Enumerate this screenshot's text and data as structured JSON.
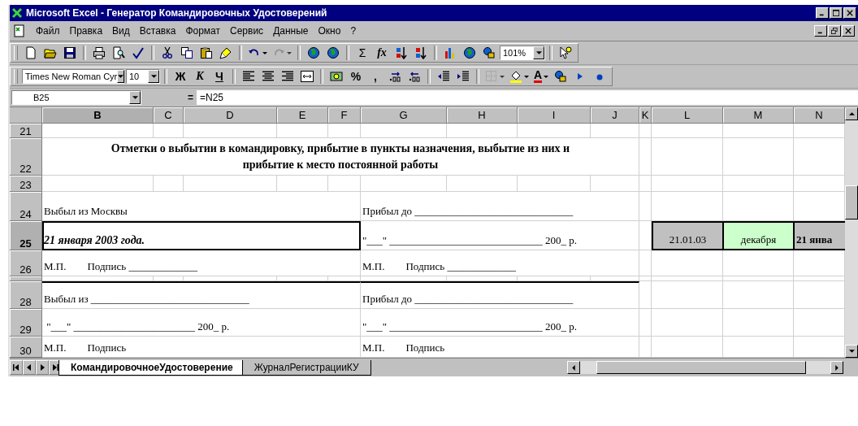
{
  "window": {
    "title": "Microsoft Excel - Генератор Командировочных Удостоверений"
  },
  "menu": [
    {
      "label": "Файл"
    },
    {
      "label": "Правка"
    },
    {
      "label": "Вид"
    },
    {
      "label": "Вставка"
    },
    {
      "label": "Формат"
    },
    {
      "label": "Сервис"
    },
    {
      "label": "Данные"
    },
    {
      "label": "Окно"
    },
    {
      "label": "?"
    }
  ],
  "standard_toolbar": [
    {
      "kind": "new"
    },
    {
      "kind": "open"
    },
    {
      "kind": "save"
    },
    {
      "kind": "sep"
    },
    {
      "kind": "print"
    },
    {
      "kind": "preview"
    },
    {
      "kind": "spell"
    },
    {
      "kind": "sep"
    },
    {
      "kind": "cut"
    },
    {
      "kind": "copy"
    },
    {
      "kind": "paste"
    },
    {
      "kind": "brush"
    },
    {
      "kind": "sep"
    },
    {
      "kind": "undo",
      "dropdown": true
    },
    {
      "kind": "redo",
      "dropdown": true,
      "disabled": true
    },
    {
      "kind": "sep"
    },
    {
      "kind": "globe"
    },
    {
      "kind": "globe"
    },
    {
      "kind": "sep"
    },
    {
      "kind": "glyph",
      "label": "Σ"
    },
    {
      "kind": "glyph-italic",
      "label": "fx"
    },
    {
      "kind": "sortasc"
    },
    {
      "kind": "sortdesc"
    },
    {
      "kind": "sep"
    },
    {
      "kind": "chart"
    },
    {
      "kind": "globe"
    },
    {
      "kind": "shapes"
    },
    {
      "kind": "zoom",
      "label": "101%"
    },
    {
      "kind": "sep"
    },
    {
      "kind": "help"
    }
  ],
  "formatting_toolbar": [
    {
      "kind": "font",
      "label": "Times New Roman Cyr"
    },
    {
      "kind": "size",
      "label": "10"
    },
    {
      "kind": "sep"
    },
    {
      "kind": "glyph-bold",
      "label": "Ж"
    },
    {
      "kind": "glyph-italic",
      "label": "К"
    },
    {
      "kind": "glyph-underline",
      "label": "Ч"
    },
    {
      "kind": "sep"
    },
    {
      "kind": "alignleft"
    },
    {
      "kind": "aligncenter"
    },
    {
      "kind": "alignright"
    },
    {
      "kind": "merge"
    },
    {
      "kind": "sep"
    },
    {
      "kind": "currency"
    },
    {
      "kind": "glyph-bold",
      "label": "%"
    },
    {
      "kind": "glyph-bold",
      "label": ","
    },
    {
      "kind": "incdec"
    },
    {
      "kind": "decdec"
    },
    {
      "kind": "sep"
    },
    {
      "kind": "outdent"
    },
    {
      "kind": "indent"
    },
    {
      "kind": "sep"
    },
    {
      "kind": "borders",
      "dropdown": true,
      "disabled": true
    },
    {
      "kind": "fill",
      "dropdown": true
    },
    {
      "kind": "fontcolor",
      "label": "A",
      "dropdown": true
    },
    {
      "kind": "shapes"
    },
    {
      "kind": "triangle"
    },
    {
      "kind": "dot"
    }
  ],
  "formula_bar": {
    "name_box": "B25",
    "equals": "=",
    "formula": "=N25"
  },
  "columns": [
    {
      "label": "B",
      "selected": true
    },
    {
      "label": "C",
      "selected": false
    },
    {
      "label": "D",
      "selected": false
    },
    {
      "label": "E",
      "selected": false
    },
    {
      "label": "F",
      "selected": false
    },
    {
      "label": "G",
      "selected": false
    },
    {
      "label": "H",
      "selected": false
    },
    {
      "label": "I",
      "selected": false
    },
    {
      "label": "J",
      "selected": false
    },
    {
      "label": "K",
      "selected": false
    },
    {
      "label": "L",
      "selected": false
    },
    {
      "label": "M",
      "selected": false
    },
    {
      "label": "N",
      "selected": false
    }
  ],
  "rows": [
    {
      "label": "21",
      "selected": false
    },
    {
      "label": "22",
      "selected": false,
      "cells": {
        "B": {
          "kind": "heading",
          "selected": false,
          "text": "Отметки о выбытии в командировку, прибытие в  пункты назначения, выбытие из них и прибытие к место постоянной работы"
        }
      }
    },
    {
      "label": "23",
      "selected": false
    },
    {
      "label": "24",
      "selected": false,
      "cells": {
        "B": {
          "selected": false,
          "text": "Выбыл из Москвы"
        },
        "G": {
          "selected": false,
          "text": "Прибыл до ______________________________"
        }
      }
    },
    {
      "label": "25",
      "selected": true,
      "cells": {
        "B": {
          "kind": "date",
          "selected": true,
          "text": "21 января 2003 года."
        },
        "G": {
          "selected": false,
          "text": "\"___\" _____________________________ 200_ р."
        },
        "L": {
          "kind": "value",
          "selected": false,
          "text": "21.01.03"
        },
        "M": {
          "kind": "highlight",
          "selected": false,
          "text": "декабря"
        },
        "N": {
          "kind": "boldvalue",
          "selected": false,
          "text": "21 янва"
        }
      }
    },
    {
      "label": "26",
      "selected": false,
      "cells": {
        "B": {
          "selected": false,
          "text": "М.П.        Подпись _____________"
        },
        "G": {
          "selected": false,
          "text": "М.П.        Подпись _____________"
        }
      }
    },
    {
      "selected": false
    },
    {
      "label": "28",
      "selected": false,
      "cells": {
        "B": {
          "selected": false,
          "text": "Выбыл из ______________________________"
        },
        "G": {
          "selected": false,
          "text": "Прибыл до ______________________________"
        }
      }
    },
    {
      "label": "29",
      "selected": false,
      "cells": {
        "B": {
          "selected": false,
          "text": " \"___\" _______________________ 200_ р."
        },
        "G": {
          "selected": false,
          "text": "\"___\" _____________________________ 200_ р."
        }
      }
    },
    {
      "label": "30",
      "selected": false,
      "cells": {
        "B": {
          "selected": false,
          "text": "М.П.        Подпись"
        },
        "G": {
          "selected": false,
          "text": "М.П.        Подпись"
        }
      }
    }
  ],
  "sheet_tabs": [
    {
      "label": "КомандировочноеУдостоверение",
      "selected": true
    },
    {
      "label": "ЖурналРегистрацииКУ",
      "selected": false
    }
  ]
}
